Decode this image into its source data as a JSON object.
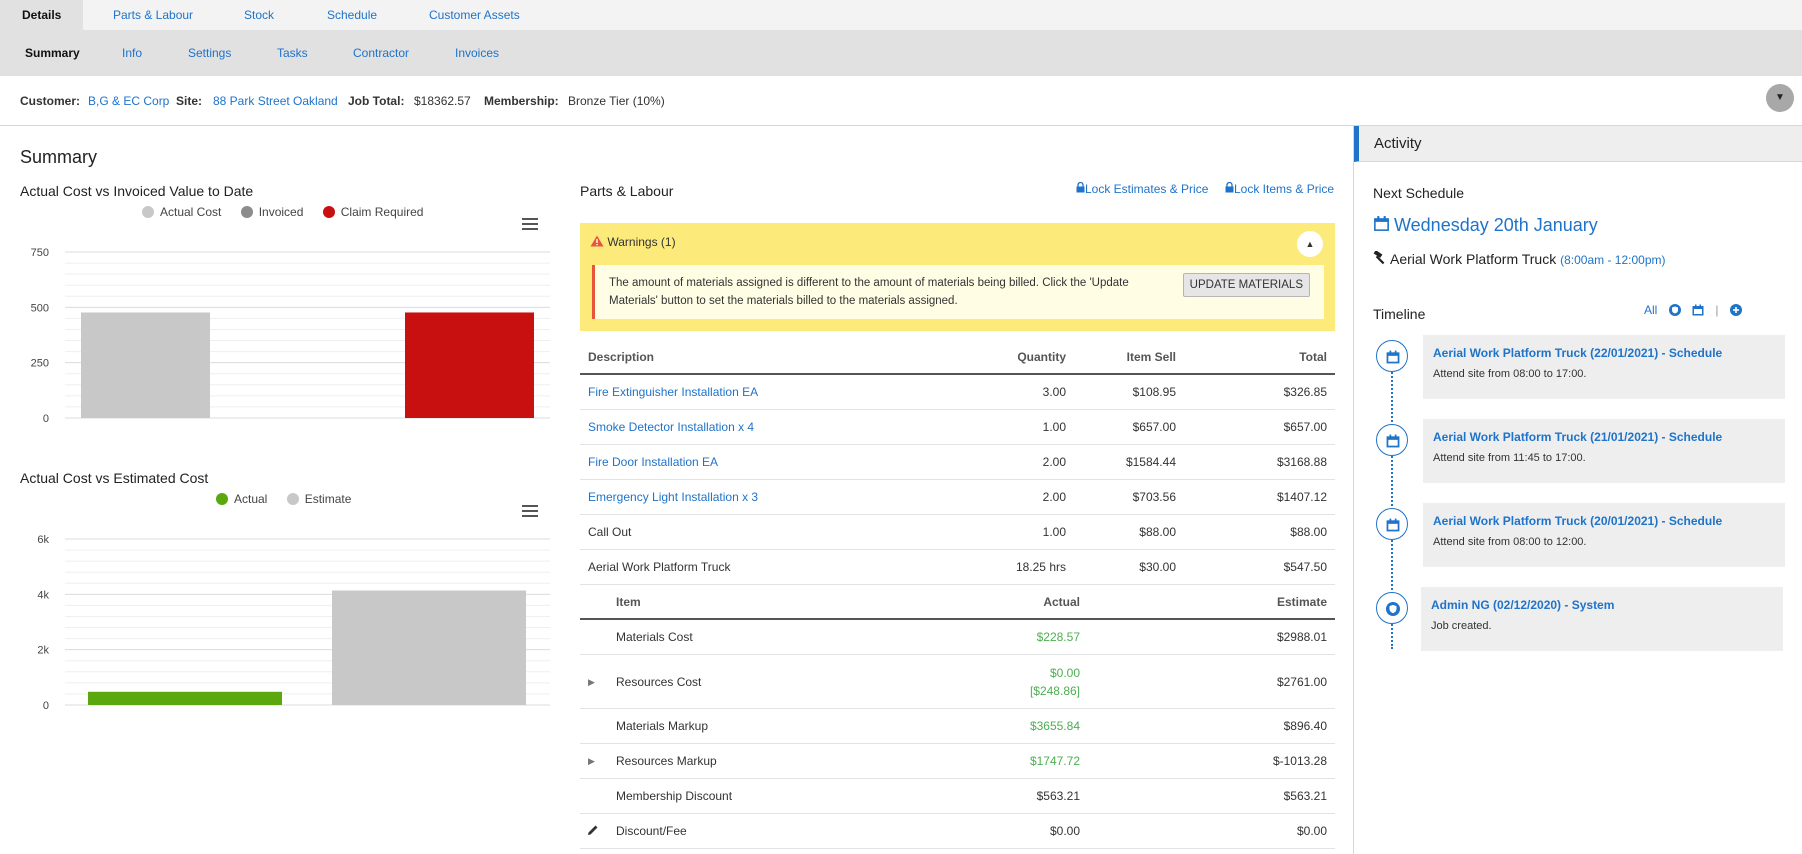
{
  "top_tabs": [
    {
      "label": "Details"
    },
    {
      "label": "Parts & Labour"
    },
    {
      "label": "Stock"
    },
    {
      "label": "Schedule"
    },
    {
      "label": "Customer Assets"
    }
  ],
  "sub_tabs": [
    {
      "label": "Summary"
    },
    {
      "label": "Info"
    },
    {
      "label": "Settings"
    },
    {
      "label": "Tasks"
    },
    {
      "label": "Contractor"
    },
    {
      "label": "Invoices"
    }
  ],
  "info": {
    "customer_label": "Customer:",
    "customer": "B,G & EC Corp",
    "site_label": "Site:",
    "site": "88 Park Street Oakland",
    "job_total_label": "Job Total:",
    "job_total": "$18362.57",
    "membership_label": "Membership:",
    "membership": "Bronze Tier (10%)"
  },
  "summary_title": "Summary",
  "chart_data": [
    {
      "type": "bar",
      "title": "Actual Cost vs Invoiced Value to Date",
      "categories": [
        "Actual Cost",
        "Invoiced",
        "Claim Required"
      ],
      "series": [
        {
          "name": "Actual Cost",
          "values": [
            476.8,
            0,
            0
          ],
          "color": "#c8c8c8"
        },
        {
          "name": "Invoiced",
          "values": [
            0,
            0,
            0
          ],
          "color": "#8c8c8c"
        },
        {
          "name": "Claim Required",
          "values": [
            0,
            0,
            476.8
          ],
          "color": "#c91010"
        }
      ],
      "yticks": [
        "0",
        "250",
        "500",
        "750"
      ],
      "ytick_values": [
        0,
        250,
        500,
        750
      ],
      "ylim": [
        0,
        750
      ],
      "grid": true,
      "legend": "top-center"
    },
    {
      "type": "bar",
      "title": "Actual Cost vs Estimated Cost",
      "categories": [
        "Actual",
        "Estimate"
      ],
      "series": [
        {
          "name": "Actual",
          "values": [
            476.8,
            0
          ],
          "color": "#5aa80e"
        },
        {
          "name": "Estimate",
          "values": [
            0,
            4137.9
          ],
          "color": "#c8c8c8"
        }
      ],
      "yticks": [
        "0",
        "2k",
        "4k",
        "6k"
      ],
      "ytick_values": [
        0,
        2000,
        4000,
        6000
      ],
      "ylim": [
        0,
        6000
      ],
      "grid": true,
      "legend": "top-center"
    }
  ],
  "parts": {
    "title": "Parts & Labour",
    "lock_estimates": "Lock Estimates & Price",
    "lock_items": "Lock Items & Price",
    "warning_title": "Warnings (1)",
    "warning_text": "The amount of materials assigned is different to the amount of materials being billed. Click the 'Update Materials' button to set the materials billed to the materials assigned.",
    "update_button": "UPDATE MATERIALS",
    "headers": {
      "description": "Description",
      "quantity": "Quantity",
      "item_sell": "Item Sell",
      "total": "Total"
    },
    "rows": [
      {
        "description": "Fire Extinguisher Installation EA",
        "quantity": "3.00",
        "item_sell": "$108.95",
        "total": "$326.85",
        "link": true
      },
      {
        "description": "Smoke Detector Installation x 4",
        "quantity": "1.00",
        "item_sell": "$657.00",
        "total": "$657.00",
        "link": true
      },
      {
        "description": "Fire Door Installation EA",
        "quantity": "2.00",
        "item_sell": "$1584.44",
        "total": "$3168.88",
        "link": true
      },
      {
        "description": "Emergency Light Installation x 3",
        "quantity": "2.00",
        "item_sell": "$703.56",
        "total": "$1407.12",
        "link": true
      },
      {
        "description": "Call Out",
        "quantity": "1.00",
        "item_sell": "$88.00",
        "total": "$88.00",
        "link": false
      },
      {
        "description": "Aerial Work Platform Truck",
        "quantity": "18.25 hrs",
        "item_sell": "$30.00",
        "total": "$547.50",
        "link": false
      }
    ],
    "cost_headers": {
      "item": "Item",
      "actual": "Actual",
      "estimate": "Estimate"
    },
    "cost_rows": [
      {
        "item": "Materials Cost",
        "actual": "$228.57",
        "actual2": "",
        "estimate": "$2988.01",
        "expand": false,
        "green": true
      },
      {
        "item": "Resources Cost",
        "actual": "$0.00",
        "actual2": "[$248.86]",
        "estimate": "$2761.00",
        "expand": true,
        "green": true
      },
      {
        "item": "Materials Markup",
        "actual": "$3655.84",
        "actual2": "",
        "estimate": "$896.40",
        "expand": false,
        "green": true
      },
      {
        "item": "Resources Markup",
        "actual": "$1747.72",
        "actual2": "",
        "estimate": "$-1013.28",
        "expand": true,
        "green": true
      },
      {
        "item": "Membership Discount",
        "actual": "$563.21",
        "actual2": "",
        "estimate": "$563.21",
        "expand": false,
        "green": false
      },
      {
        "item": "Discount/Fee",
        "actual": "$0.00",
        "actual2": "",
        "estimate": "$0.00",
        "expand": false,
        "green": false,
        "edit": true
      }
    ]
  },
  "activity": {
    "title": "Activity",
    "next_schedule_label": "Next Schedule",
    "next_date": "Wednesday 20th January",
    "next_job": "Aerial Work Platform Truck",
    "next_time": "(8:00am - 12:00pm)",
    "timeline_label": "Timeline",
    "filter_all": "All",
    "timeline": [
      {
        "title": "Aerial Work Platform Truck (22/01/2021) - Schedule",
        "detail": "Attend site from 08:00 to 17:00.",
        "icon": "calendar-icon"
      },
      {
        "title": "Aerial Work Platform Truck (21/01/2021) - Schedule",
        "detail": "Attend site from 11:45 to 17:00.",
        "icon": "calendar-icon"
      },
      {
        "title": "Aerial Work Platform Truck (20/01/2021) - Schedule",
        "detail": "Attend site from 08:00 to 12:00.",
        "icon": "calendar-icon"
      },
      {
        "title": "Admin NG (02/12/2020) - System",
        "detail": "Job created.",
        "icon": "shield-icon"
      }
    ]
  }
}
